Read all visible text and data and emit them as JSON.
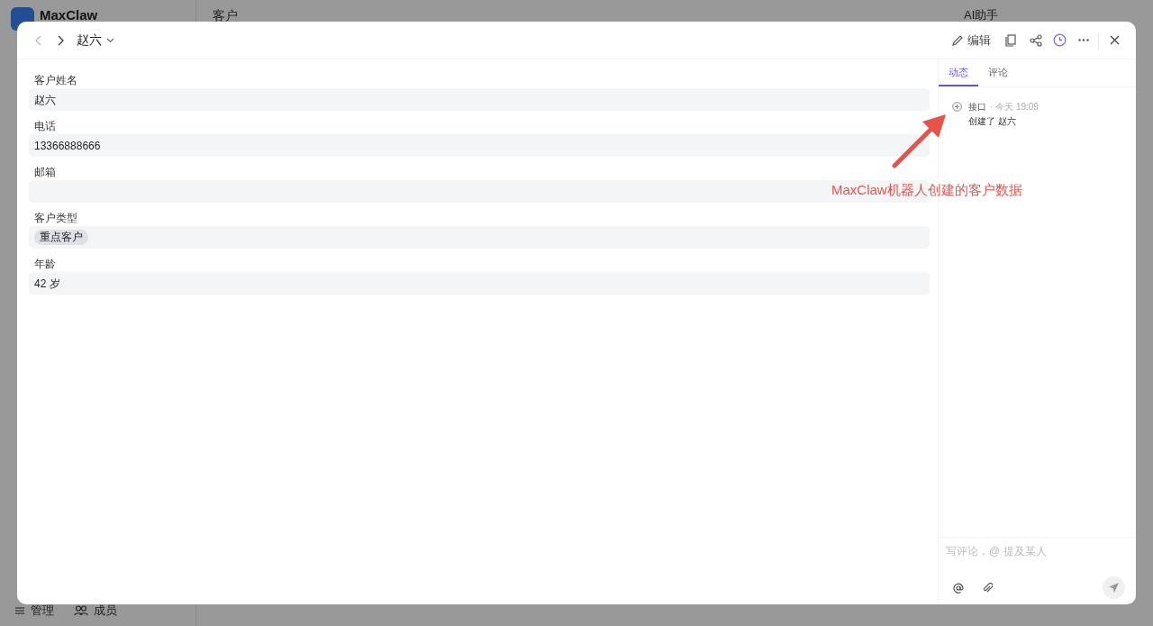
{
  "background": {
    "app_name": "MaxClaw",
    "view_title": "客户",
    "ai_assistant": "AI助手",
    "footer_items": [
      {
        "label": "管理",
        "kind": "manage"
      },
      {
        "label": "成员",
        "kind": "members"
      }
    ]
  },
  "record": {
    "title": "赵六",
    "fields": [
      {
        "label": "客户姓名",
        "kind": "text",
        "value": "赵六"
      },
      {
        "label": "电话",
        "kind": "text",
        "value": "13366888666"
      },
      {
        "label": "邮箱",
        "kind": "text"
      },
      {
        "label": "客户类型",
        "kind": "tag",
        "value": "重点客户"
      },
      {
        "label": "年龄",
        "kind": "text",
        "value": "42 岁"
      }
    ]
  },
  "toolbar": {
    "edit": "编辑",
    "history_active": true
  },
  "side_panel": {
    "tabs": [
      {
        "label": "动态",
        "selected": true
      },
      {
        "label": "评论",
        "selected": false
      }
    ],
    "activity": [
      {
        "source": "接口",
        "time": "· 今天 19:09",
        "text": "创建了 赵六"
      }
    ],
    "comment": {
      "placeholder": "写评论，@ 提及某人"
    }
  },
  "annotation": {
    "text": "MaxClaw机器人创建的客户数据"
  }
}
